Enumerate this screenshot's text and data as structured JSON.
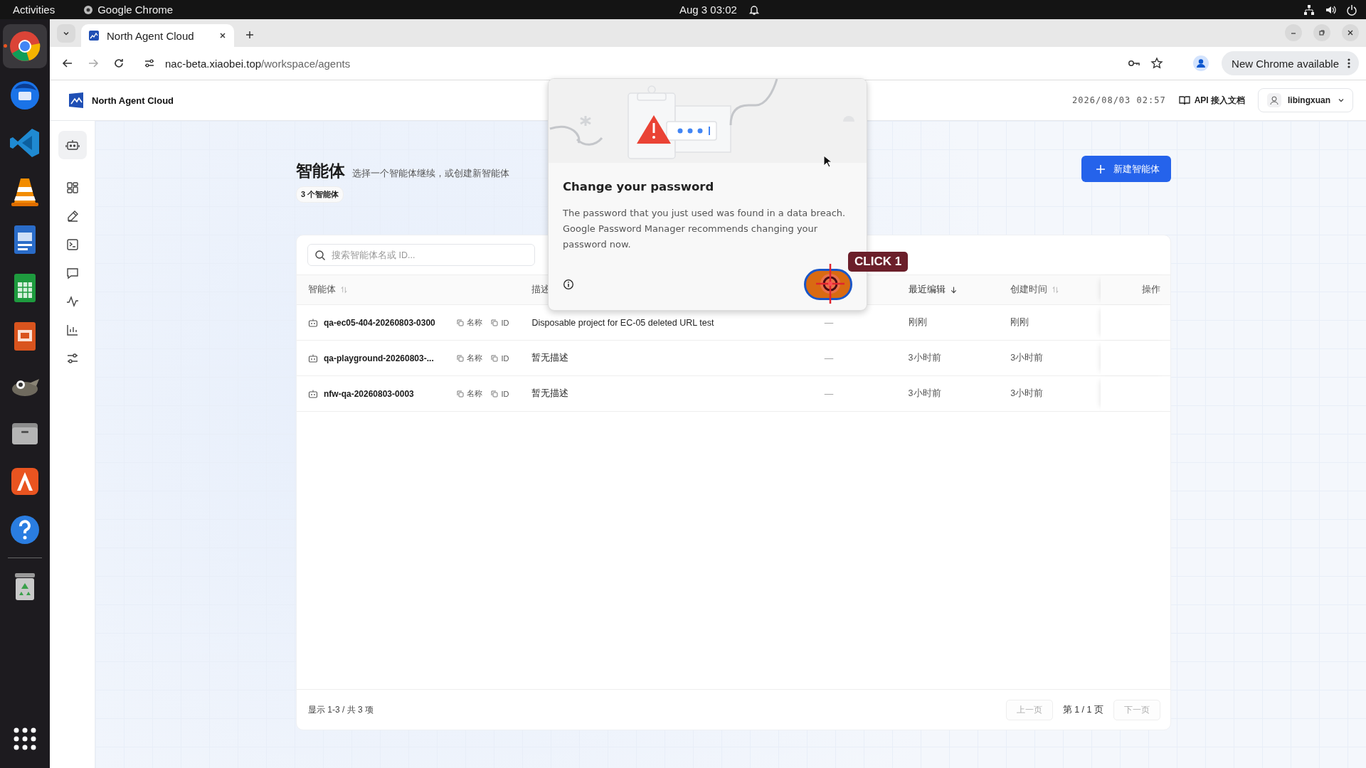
{
  "system_bar": {
    "activities": "Activities",
    "app": "Google Chrome",
    "clock": "Aug 3  03:02"
  },
  "dock": [
    {
      "kind": "chrome",
      "selected": true
    },
    {
      "kind": "mail",
      "selected": false
    },
    {
      "kind": "code",
      "selected": false
    },
    {
      "kind": "cone",
      "selected": false
    },
    {
      "kind": "writer",
      "selected": false
    },
    {
      "kind": "calc",
      "selected": false
    },
    {
      "kind": "impress",
      "selected": false
    },
    {
      "kind": "gimp",
      "selected": false
    },
    {
      "kind": "files",
      "selected": false
    },
    {
      "kind": "store",
      "selected": false
    },
    {
      "kind": "help",
      "selected": false
    },
    {
      "kind": "trash",
      "selected": false
    },
    {
      "kind": "grid",
      "selected": false
    }
  ],
  "browser": {
    "tab_title": "North Agent Cloud",
    "url_host": "nac-beta.xiaobei.top",
    "url_path": "/workspace/agents",
    "update_button": "New Chrome available"
  },
  "app_header": {
    "brand": "North Agent Cloud",
    "datetime": "2026/08/03 02:57",
    "docs_link": "API 接入文档",
    "user": "libingxuan"
  },
  "sidebar": [
    {
      "kind": "robot",
      "selected": true
    },
    {
      "kind": "grid",
      "selected": false
    },
    {
      "kind": "pencil",
      "selected": false
    },
    {
      "kind": "terminal",
      "selected": false
    },
    {
      "kind": "chat",
      "selected": false
    },
    {
      "kind": "pulse",
      "selected": false
    },
    {
      "kind": "chart",
      "selected": false
    },
    {
      "kind": "sliders",
      "selected": false
    }
  ],
  "page": {
    "title": "智能体",
    "subtitle": "选择一个智能体继续，或创建新智能体",
    "count": "3 个智能体",
    "new_button": "新建智能体"
  },
  "search": {
    "placeholder": "搜索智能体名或 ID..."
  },
  "table": {
    "columns": [
      {
        "label": "智能体",
        "sorted": false
      },
      {
        "label": "描述"
      },
      {
        "label": "最近编辑",
        "sorted": true
      },
      {
        "label": "创建时间",
        "sorted": false
      },
      {
        "label": "操作"
      }
    ],
    "rows": [
      {
        "name": "qa-ec05-404-20260803-0300",
        "copy_name": "名称",
        "copy_id": "ID",
        "description": "Disposable project for EC-05 deleted URL test",
        "column_3": "—",
        "edited": "刚刚",
        "created": "刚刚"
      },
      {
        "name": "qa-playground-20260803-...",
        "copy_name": "名称",
        "copy_id": "ID",
        "description": "暂无描述",
        "column_3": "—",
        "edited": "3小时前",
        "created": "3小时前"
      },
      {
        "name": "nfw-qa-20260803-0003",
        "copy_name": "名称",
        "copy_id": "ID",
        "description": "暂无描述",
        "column_3": "—",
        "edited": "3小时前",
        "created": "3小时前"
      }
    ]
  },
  "footer": {
    "summary": "显示 1-3 / 共 3 项",
    "prev": {
      "label": "上一页",
      "disabled": true
    },
    "page": "第 1 / 1 页",
    "next": {
      "label": "下一页",
      "disabled": true
    }
  },
  "dialog": {
    "title": "Change your password",
    "body": "The password that you just used was found in a data breach. Google Password Manager recommends changing your password now.",
    "annotation": "CLICK 1"
  }
}
